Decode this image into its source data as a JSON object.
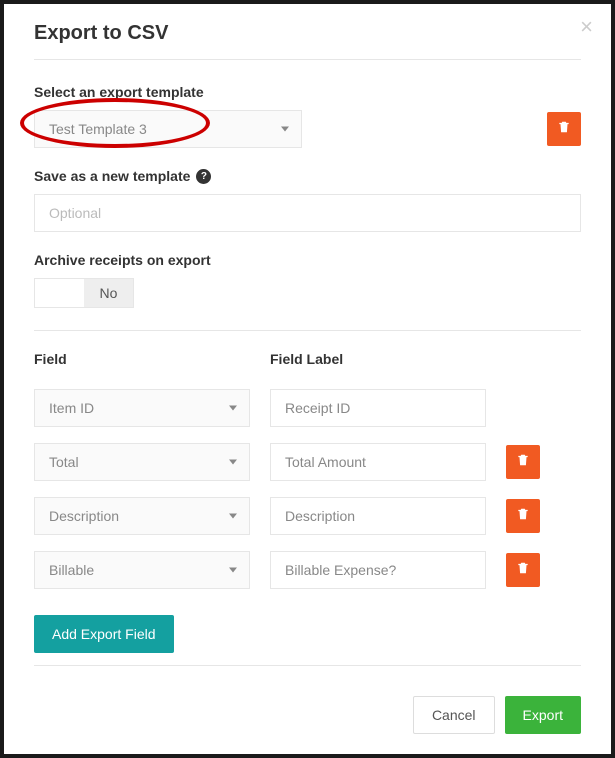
{
  "modal": {
    "title": "Export to CSV",
    "close_label": "×"
  },
  "template_section": {
    "label": "Select an export template",
    "selected": "Test Template 3"
  },
  "save_section": {
    "label": "Save as a new template",
    "placeholder": "Optional"
  },
  "archive_section": {
    "label": "Archive receipts on export",
    "no_label": "No"
  },
  "fields": {
    "header_field": "Field",
    "header_label": "Field Label",
    "rows": [
      {
        "field": "Item ID",
        "label": "Receipt ID",
        "deletable": false
      },
      {
        "field": "Total",
        "label": "Total Amount",
        "deletable": true
      },
      {
        "field": "Description",
        "label": "Description",
        "deletable": true
      },
      {
        "field": "Billable",
        "label": "Billable Expense?",
        "deletable": true
      }
    ]
  },
  "buttons": {
    "add_field": "Add Export Field",
    "cancel": "Cancel",
    "export": "Export"
  }
}
